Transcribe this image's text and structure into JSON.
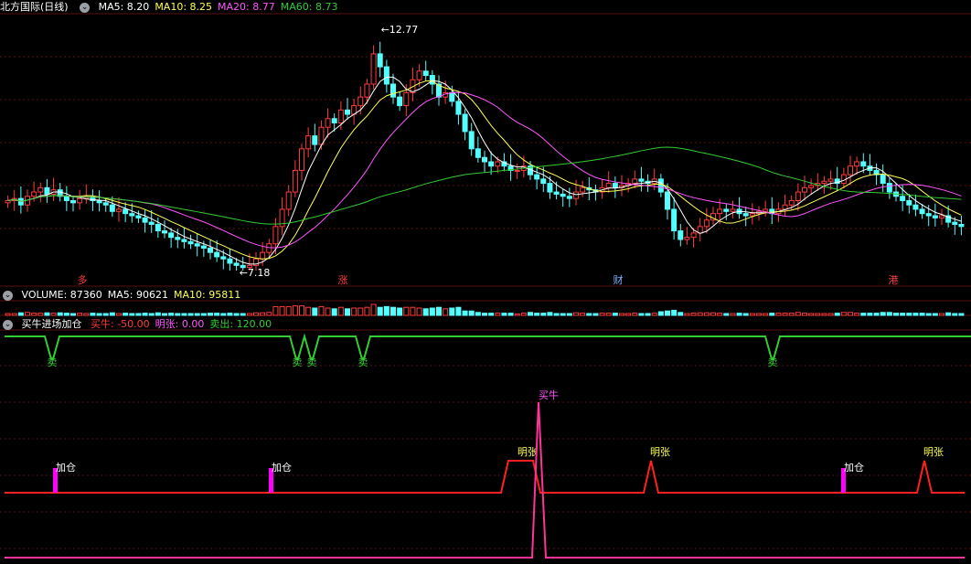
{
  "stock": {
    "name": "北方国际",
    "period": "(日线)"
  },
  "colors": {
    "up": "#ff3c3c",
    "down": "#54ffff",
    "ma5": "#ffffff",
    "ma10": "#ffff55",
    "ma20": "#ff55ff",
    "ma60": "#33cc33",
    "sell": "#33cc33",
    "buy": "#ff3399",
    "mingzhang": "#ff2020",
    "jiacang": "#ff00ff",
    "grid": "#5a1010"
  },
  "price_panel": {
    "ma_labels": [
      {
        "text": "MA5: 8.20",
        "color": "#ffffff"
      },
      {
        "text": "MA10: 8.25",
        "color": "#ffff55"
      },
      {
        "text": "MA20: 8.77",
        "color": "#ff55ff"
      },
      {
        "text": "MA60: 8.73",
        "color": "#33cc33"
      }
    ],
    "high_label": "12.77",
    "low_label": "7.18",
    "event_markers": [
      "多",
      "涨",
      "财",
      "港"
    ]
  },
  "volume_panel": {
    "labels": [
      {
        "text": "VOLUME: 87360",
        "color": "#ffffff"
      },
      {
        "text": "MA5: 90621",
        "color": "#ffffff"
      },
      {
        "text": "MA10: 95811",
        "color": "#ffff55"
      }
    ]
  },
  "indicator_panel": {
    "name": "买牛进场加仓",
    "labels": [
      {
        "text": "买牛: -50.00",
        "color": "#ff3c3c"
      },
      {
        "text": "明张: 0.00",
        "color": "#ff55ff"
      },
      {
        "text": "卖出: 120.00",
        "color": "#33cc33"
      }
    ],
    "sell_label": "卖",
    "buy_label": "买牛",
    "mingzhang_label": "明张",
    "jiacang_label": "加仓"
  },
  "chart_data": {
    "type": "candlestick",
    "price_range": [
      7.18,
      12.77
    ],
    "closes": [
      8.8,
      8.85,
      8.7,
      8.9,
      9.0,
      9.1,
      8.95,
      9.05,
      8.9,
      8.8,
      8.75,
      8.85,
      8.9,
      8.8,
      8.75,
      8.7,
      8.55,
      8.6,
      8.5,
      8.45,
      8.4,
      8.3,
      8.25,
      8.1,
      8.05,
      7.95,
      7.9,
      7.85,
      7.8,
      7.75,
      7.7,
      7.6,
      7.5,
      7.45,
      7.35,
      7.3,
      7.25,
      7.3,
      7.45,
      7.6,
      7.8,
      8.2,
      8.6,
      9.0,
      9.5,
      10.0,
      10.3,
      10.1,
      10.5,
      10.7,
      10.6,
      10.9,
      10.8,
      11.0,
      11.2,
      11.5,
      12.2,
      11.9,
      11.5,
      11.2,
      11.0,
      11.3,
      11.6,
      11.8,
      11.7,
      11.5,
      11.2,
      11.3,
      11.1,
      10.8,
      10.4,
      10.0,
      9.8,
      9.7,
      9.6,
      9.7,
      9.6,
      9.5,
      9.5,
      9.6,
      9.4,
      9.3,
      9.2,
      9.0,
      8.95,
      8.9,
      8.85,
      9.0,
      9.1,
      9.05,
      9.0,
      9.1,
      9.2,
      9.1,
      9.15,
      9.2,
      9.3,
      9.25,
      9.2,
      9.3,
      9.0,
      8.6,
      8.1,
      7.9,
      7.95,
      8.05,
      8.2,
      8.35,
      8.5,
      8.6,
      8.55,
      8.6,
      8.5,
      8.45,
      8.5,
      8.55,
      8.6,
      8.5,
      8.6,
      8.7,
      8.8,
      9.0,
      9.1,
      9.15,
      9.2,
      9.25,
      9.3,
      9.2,
      9.4,
      9.6,
      9.7,
      9.6,
      9.5,
      9.4,
      9.2,
      9.0,
      8.9,
      8.8,
      8.7,
      8.6,
      8.5,
      8.45,
      8.4,
      8.45,
      8.3,
      8.25,
      8.2
    ]
  }
}
